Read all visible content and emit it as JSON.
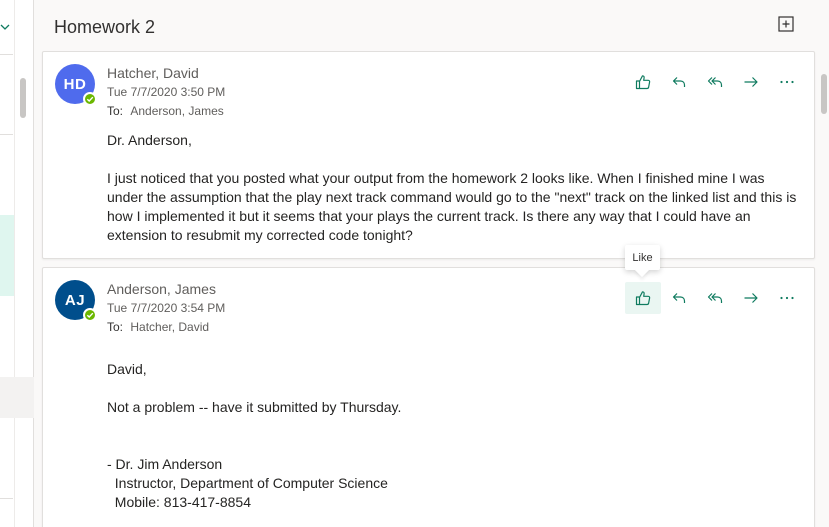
{
  "reading_pane": {
    "subject": "Homework 2"
  },
  "messages": [
    {
      "initials": "HD",
      "avatar_color": "#4f6bed",
      "sender": "Hatcher, David",
      "date": "Tue 7/7/2020 3:50 PM",
      "to_label": "To:",
      "to": "Anderson, James",
      "body": [
        "Dr. Anderson,",
        "",
        "I just noticed that you posted what your output from the homework 2 looks like. When I finished mine I was under the assumption that the play next track command would go to the \"next\" track on the linked list and this is how I implemented it but it seems that your plays the current track. Is there any way that I could have an extension to resubmit my corrected code tonight?"
      ]
    },
    {
      "initials": "AJ",
      "avatar_color": "#004e8c",
      "sender": "Anderson, James",
      "date": "Tue 7/7/2020 3:54 PM",
      "to_label": "To:",
      "to": "Hatcher, David",
      "body": [
        "David,",
        "",
        "Not a problem -- have it submitted by Thursday.",
        "",
        "",
        "- Dr. Jim Anderson",
        "  Instructor, Department of Computer Science",
        "  Mobile: 813-417-8854"
      ]
    }
  ],
  "actions": {
    "icons": [
      "like-icon",
      "reply-icon",
      "reply-all-icon",
      "forward-icon",
      "more-icon"
    ],
    "accent_color": "#0f7b5f"
  },
  "tooltip": {
    "text": "Like"
  }
}
